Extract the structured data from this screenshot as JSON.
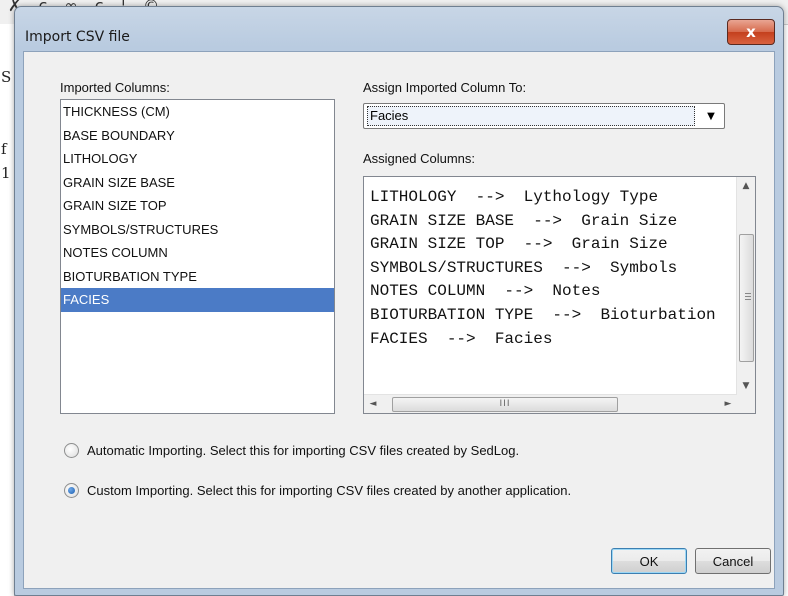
{
  "background": {
    "glyphs": "✗ ɕ ∞ ɕ ¦ ©",
    "side_letters": [
      "S",
      "f",
      "1"
    ]
  },
  "window": {
    "title": "Import CSV file",
    "close_glyph": "x"
  },
  "imported": {
    "label": "Imported Columns:",
    "items": [
      "THICKNESS (CM)",
      "BASE BOUNDARY",
      "LITHOLOGY",
      "GRAIN SIZE BASE",
      "GRAIN SIZE TOP",
      "SYMBOLS/STRUCTURES",
      "NOTES COLUMN",
      "BIOTURBATION TYPE",
      "FACIES"
    ],
    "selected_index": 8
  },
  "assign": {
    "label": "Assign Imported Column To:",
    "value": "Facies",
    "arrow": "▼"
  },
  "assigned": {
    "label": "Assigned Columns:",
    "lines": [
      "LITHOLOGY  -->  Lythology Type",
      "GRAIN SIZE BASE  -->  Grain Size",
      "GRAIN SIZE TOP  -->  Grain Size",
      "SYMBOLS/STRUCTURES  -->  Symbols",
      "NOTES COLUMN  -->  Notes",
      "BIOTURBATION TYPE  -->  Bioturbation",
      "FACIES  -->  Facies"
    ],
    "scroll": {
      "up": "▲",
      "down": "▼",
      "left": "◄",
      "right": "►",
      "thumb_grip": "III"
    }
  },
  "options": {
    "automatic": {
      "label": "Automatic Importing. Select this for importing CSV files created by SedLog.",
      "checked": false
    },
    "custom": {
      "label": "Custom Importing. Select this for importing CSV files created by another application.",
      "checked": true
    }
  },
  "buttons": {
    "ok": "OK",
    "cancel": "Cancel"
  }
}
